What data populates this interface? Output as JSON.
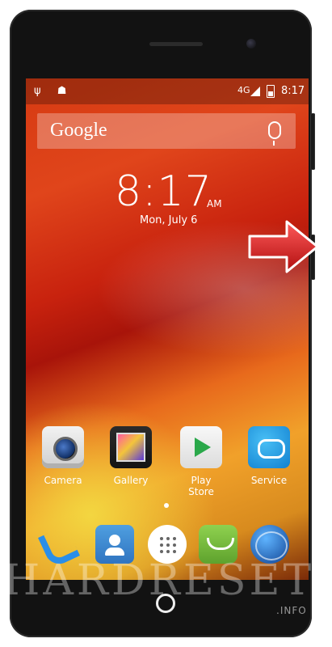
{
  "status_bar": {
    "network": "4G",
    "time": "8:17"
  },
  "search_widget": {
    "logo": "Google"
  },
  "clock_widget": {
    "time": "8:17",
    "ampm": "AM",
    "date": "Mon, July 6"
  },
  "home_apps": [
    {
      "label": "Camera",
      "icon": "camera-icon"
    },
    {
      "label": "Gallery",
      "icon": "gallery-icon"
    },
    {
      "label": "Play Store",
      "icon": "play-store-icon"
    },
    {
      "label": "Service",
      "icon": "service-icon"
    }
  ],
  "dock": [
    {
      "icon": "phone-icon"
    },
    {
      "icon": "contacts-icon"
    },
    {
      "icon": "apps-drawer-icon"
    },
    {
      "icon": "messaging-icon"
    },
    {
      "icon": "browser-globe-icon"
    }
  ],
  "watermark": {
    "text": "HARDRESET",
    "sub": ".INFO"
  },
  "colors": {
    "arrow_red": "#d81e1e",
    "bezel": "#121212"
  }
}
